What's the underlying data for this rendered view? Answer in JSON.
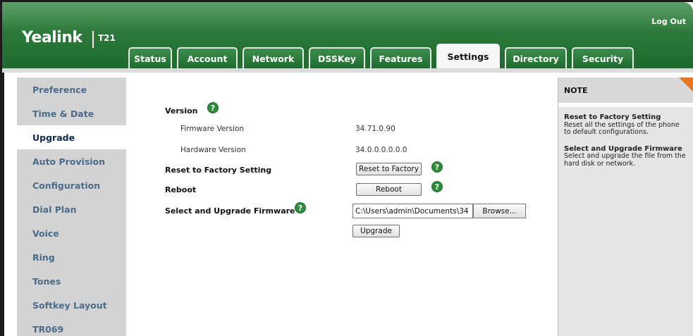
{
  "header": {
    "logo": "Yealink",
    "model": "T21",
    "logout": "Log Out"
  },
  "tabs": [
    {
      "label": "Status",
      "active": false
    },
    {
      "label": "Account",
      "active": false
    },
    {
      "label": "Network",
      "active": false
    },
    {
      "label": "DSSKey",
      "active": false
    },
    {
      "label": "Features",
      "active": false
    },
    {
      "label": "Settings",
      "active": true
    },
    {
      "label": "Directory",
      "active": false
    },
    {
      "label": "Security",
      "active": false
    }
  ],
  "sidebar": {
    "items": [
      {
        "label": "Preference"
      },
      {
        "label": "Time & Date"
      },
      {
        "label": "Upgrade",
        "active": true
      },
      {
        "label": "Auto Provision"
      },
      {
        "label": "Configuration"
      },
      {
        "label": "Dial Plan"
      },
      {
        "label": "Voice"
      },
      {
        "label": "Ring"
      },
      {
        "label": "Tones"
      },
      {
        "label": "Softkey Layout"
      },
      {
        "label": "TR069"
      }
    ]
  },
  "main": {
    "version_label": "Version",
    "firmware_label": "Firmware Version",
    "firmware_value": "34.71.0.90",
    "hardware_label": "Hardware Version",
    "hardware_value": "34.0.0.0.0.0.0",
    "reset_label": "Reset to Factory Setting",
    "reset_button": "Reset to Factory",
    "reboot_label": "Reboot",
    "reboot_button": "Reboot",
    "upgrade_label": "Select and Upgrade Firmware",
    "file_path": "C:\\Users\\admin\\Documents\\34",
    "browse_button": "Browse...",
    "upgrade_button": "Upgrade",
    "help_glyph": "?"
  },
  "note": {
    "title": "NOTE",
    "blocks": [
      {
        "title": "Reset to Factory Setting",
        "text": "Reset all the settings of the phone to default configurations."
      },
      {
        "title": "Select and Upgrade Firmware",
        "text": "Select and upgrade the file from the hard disk or network."
      }
    ]
  },
  "colors": {
    "header_green": "#2d7a3b",
    "sidebar_bg": "#d3d3d3",
    "sidebar_text": "#4a6b8c",
    "note_corner": "#e87722",
    "help_green": "#2e8b3c"
  }
}
